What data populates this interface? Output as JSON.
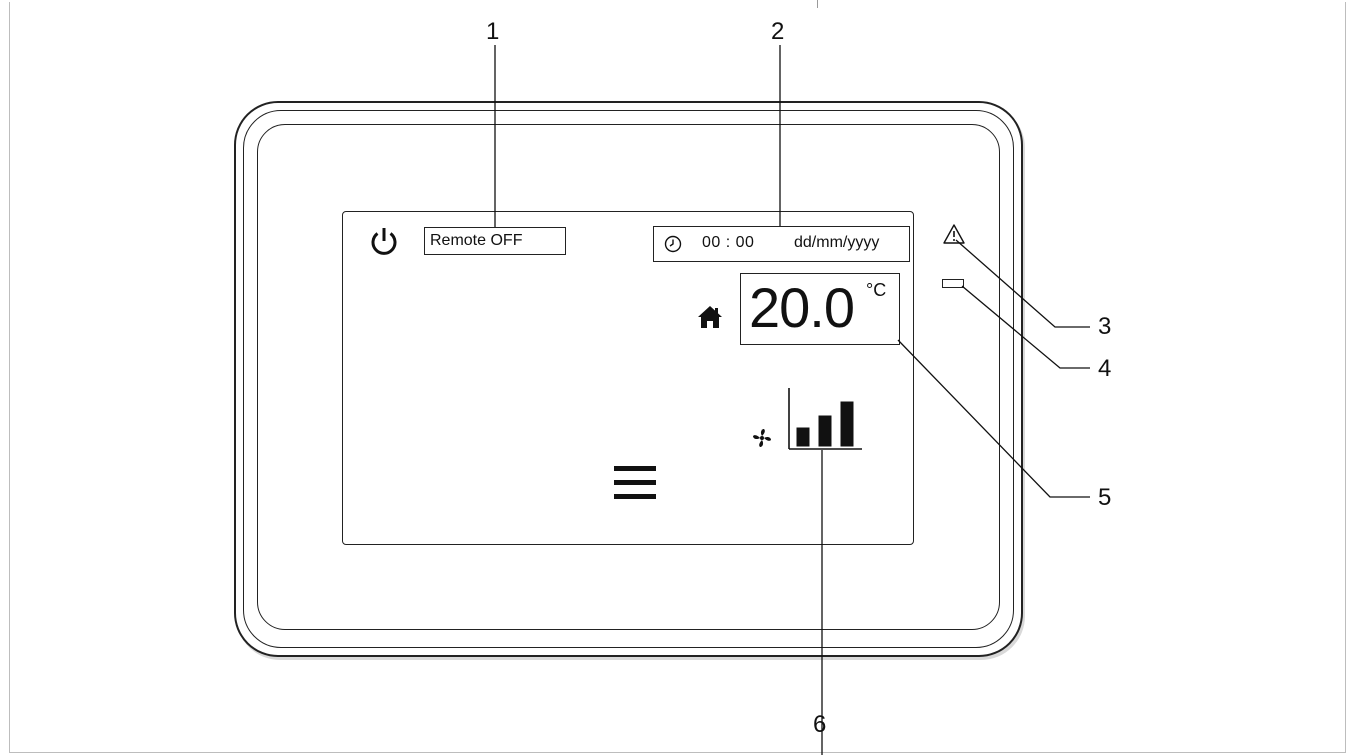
{
  "screen": {
    "remote_status": "Remote OFF",
    "time": "00 : 00",
    "date": "dd/mm/yyyy",
    "temperature": "20.0",
    "temperature_unit": "°C",
    "fan_level": {
      "value": 3,
      "max": 3
    }
  },
  "icons": {
    "power": "power-icon",
    "clock": "clock-icon",
    "home": "home-icon",
    "fan": "fan-icon",
    "menu": "menu-icon",
    "warning": "warning-icon",
    "led": "status-led"
  },
  "callouts": [
    "1",
    "2",
    "3",
    "4",
    "5",
    "6"
  ]
}
